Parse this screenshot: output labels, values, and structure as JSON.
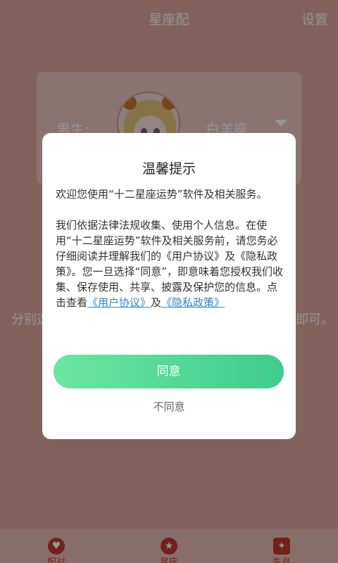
{
  "header": {
    "title": "星座配",
    "settings_label": "设置"
  },
  "selector": {
    "gender_label": "男生:",
    "sign_value": "白羊座"
  },
  "background_hint": {
    "left_text": "分别选",
    "right_text": "即可。"
  },
  "tabs": [
    {
      "label": "配对",
      "icon": "heart-icon"
    },
    {
      "label": "星座",
      "icon": "star-icon"
    },
    {
      "label": "生肖",
      "icon": "zodiac-icon"
    }
  ],
  "dialog": {
    "title": "温馨提示",
    "para1": "欢迎您使用“十二星座运势”软件及相关服务。",
    "para2_text": "我们依据法律法规收集、使用个人信息。在使用“十二星座运势”软件及相关服务前，请您务必仔细阅读并理解我们的《用户协议》及《隐私政策》。您一旦选择“同意”，即意味着您授权我们收集、保存使用、共享、披露及保护您的信息。点击查看",
    "link_user_agreement": "《用户协议》",
    "and_text": "及",
    "link_privacy_policy": "《隐私政策》",
    "agree_label": "同意",
    "disagree_label": "不同意"
  },
  "colors": {
    "accent_green": "#3fcc8c",
    "link_blue": "#2f86c9",
    "tab_red": "#c8372f"
  }
}
